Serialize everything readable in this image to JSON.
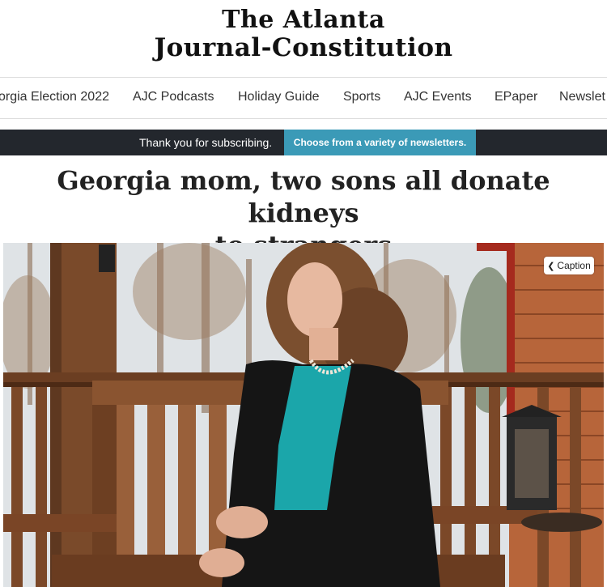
{
  "masthead": {
    "line1": "The Atlanta",
    "line2": "Journal-Constitution"
  },
  "nav": {
    "items": [
      "orgia Election 2022",
      "AJC Podcasts",
      "Holiday Guide",
      "Sports",
      "AJC Events",
      "EPaper",
      "Newslet"
    ]
  },
  "banner": {
    "message": "Thank you for subscribing.",
    "cta": "Choose from a variety of newsletters."
  },
  "article": {
    "headline_line1": "Georgia mom, two sons all donate kidneys",
    "headline_line2": "to strangers"
  },
  "photo": {
    "caption_button": "Caption",
    "caption_icon": "chevron-left-icon"
  },
  "colors": {
    "banner_bg": "#23272d",
    "cta_bg": "#3b9ab7"
  }
}
